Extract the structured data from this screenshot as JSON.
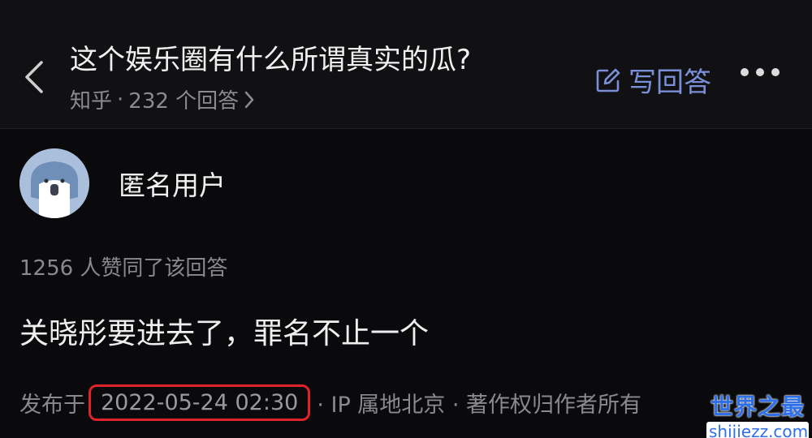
{
  "header": {
    "title": "这个娱乐圈有什么所谓真实的瓜?",
    "source": "知乎",
    "separator": "·",
    "answer_count_label": "232 个回答",
    "write_label": "写回答"
  },
  "author": {
    "name": "匿名用户"
  },
  "answer": {
    "votes_label": "1256 人赞同了该回答",
    "content": "关晓彤要进去了，罪名不止一个",
    "meta_prefix": "发布于",
    "date": "2022-05-24 02:30",
    "meta_suffix": "· IP 属地北京 · 著作权归作者所有"
  },
  "watermark": {
    "title": "世界之最",
    "url": "shijiezz.com"
  },
  "colors": {
    "background": "#0a0a0c",
    "accent": "#7a8fd8",
    "highlight_box": "#e0232a",
    "watermark": "#2f6fe8"
  },
  "icons": [
    "back-chevron-icon",
    "edit-icon",
    "chevron-right-icon",
    "more-icon"
  ]
}
